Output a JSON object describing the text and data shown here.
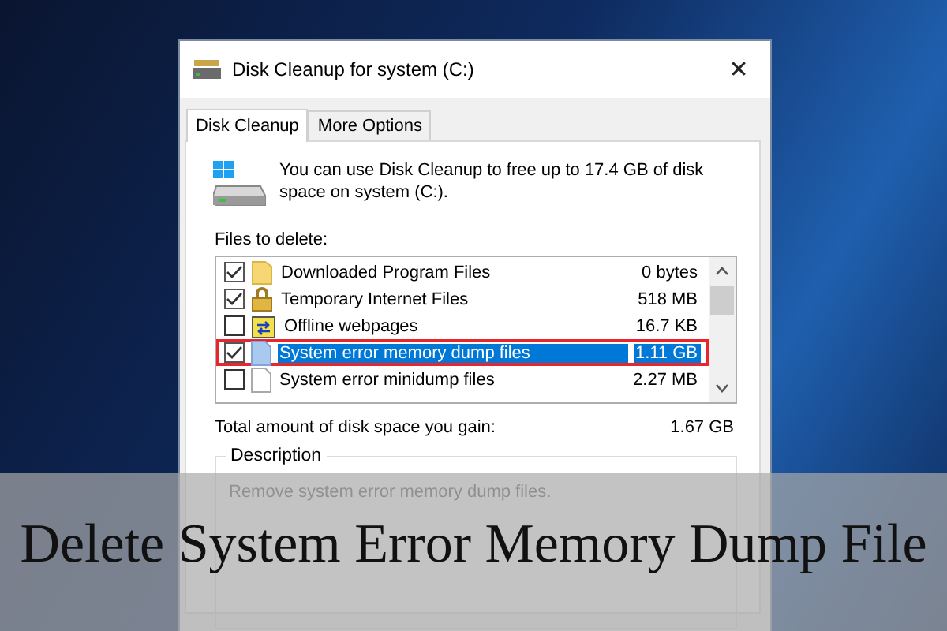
{
  "window": {
    "title": "Disk Cleanup for system (C:)",
    "close": "✕"
  },
  "tabs": [
    {
      "label": "Disk Cleanup",
      "selected": true
    },
    {
      "label": "More Options",
      "selected": false
    }
  ],
  "intro": "You can use Disk Cleanup to free up to 17.4 GB of disk space on system (C:).",
  "files_label": "Files to delete:",
  "files": [
    {
      "kind": "folder",
      "name": "Downloaded Program Files",
      "size": "0 bytes",
      "checked": true,
      "selected": false
    },
    {
      "kind": "lock",
      "name": "Temporary Internet Files",
      "size": "518 MB",
      "checked": true,
      "selected": false
    },
    {
      "kind": "sync",
      "name": "Offline webpages",
      "size": "16.7 KB",
      "checked": false,
      "selected": false
    },
    {
      "kind": "doc",
      "name": "System error memory dump files",
      "size": "1.11 GB",
      "checked": true,
      "selected": true
    },
    {
      "kind": "page",
      "name": "System error minidump files",
      "size": "2.27 MB",
      "checked": false,
      "selected": false
    }
  ],
  "total": {
    "label": "Total amount of disk space you gain:",
    "value": "1.67 GB"
  },
  "description": {
    "title": "Description",
    "text": "Remove system error memory dump files."
  },
  "caption": "Delete System Error Memory Dump File"
}
